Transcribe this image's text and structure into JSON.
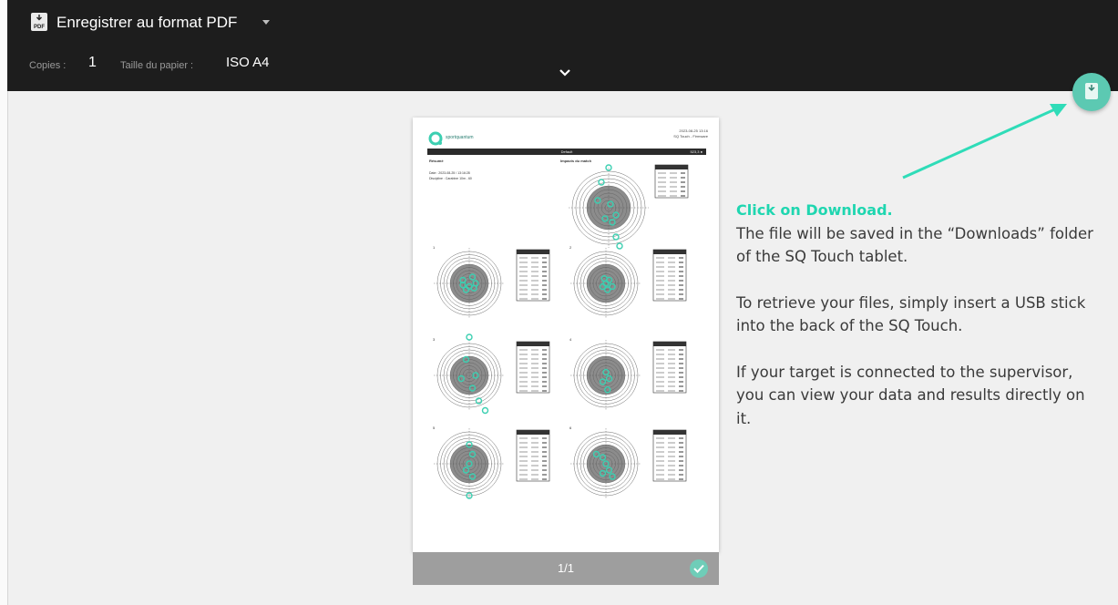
{
  "print_dialog": {
    "destination": "Enregistrer au format PDF",
    "destination_icon": "pdf-save-icon",
    "pdf_badge": "PDF",
    "copies_label": "Copies :",
    "copies_value": "1",
    "paper_label": "Taille du papier :",
    "paper_value": "ISO A4",
    "expand_icon": "chevron-down-icon",
    "download_button_icon": "save-pdf-icon",
    "accent_color": "#5cc9b2"
  },
  "preview": {
    "page_counter": "1/1",
    "confirm_icon": "check-icon",
    "logo_text": "sportquantum",
    "header_right_line1": "2023-08-25 13:16",
    "header_right_line2": "SQ Touch - Firmware",
    "band_center": "Default",
    "band_right": "523,3 ●",
    "section_left": "Résumé",
    "section_center": "Impacts du match",
    "info_line1": "Date : 2023-08-25 / 13:16:28",
    "info_line2": "Discipline : Carabine 10m - 60",
    "series_labels": [
      "1",
      "2",
      "3",
      "4",
      "5",
      "6"
    ]
  },
  "annotation": {
    "heading": "Click on Download.",
    "line1": " The file will be saved in the “Downloads” folder of the SQ Touch tablet.",
    "line2": "To retrieve your files, simply insert a USB stick into the back of the SQ Touch.",
    "line3": "If your target is connected to the supervisor, you can view your data and results directly on it.",
    "heading_color": "#1fd6b0",
    "arrow_color": "#2fdcb8"
  }
}
